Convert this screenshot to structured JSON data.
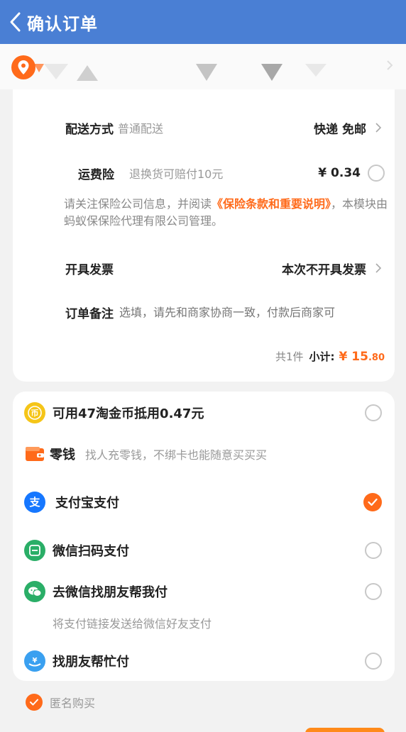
{
  "header": {
    "title": "确认订单"
  },
  "order": {
    "delivery": {
      "label": "配送方式",
      "sub": "普通配送",
      "value": "快递 免邮"
    },
    "insurance": {
      "label": "运费险",
      "sub": "退换货可赔付10元",
      "value": "¥ 0.34"
    },
    "notice": {
      "pre": "请关注保险公司信息，并阅读",
      "link": "《保险条款和重要说明》",
      "post": "，本模块由蚂蚁保保险代理有限公司管理。"
    },
    "invoice": {
      "label": "开具发票",
      "value": "本次不开具发票"
    },
    "remark": {
      "label": "订单备注",
      "placeholder": "选填，请先和商家协商一致，付款后商家可"
    },
    "total": {
      "count": "共1件",
      "subtotal_label": "小计:",
      "currency": "¥",
      "amount_int": "15",
      "amount_dec": ".80"
    }
  },
  "payment": {
    "coins": {
      "label": "可用47淘金币抵用0.47元"
    },
    "wallet": {
      "label": "零钱",
      "hint": "找人充零钱，不绑卡也能随意买买买"
    },
    "alipay": {
      "label": "支付宝支付",
      "selected": true
    },
    "wechat_scan": {
      "label": "微信扫码支付"
    },
    "wechat_friend": {
      "label": "去微信找朋友帮我付",
      "sub": "将支付链接发送给微信好友支付"
    },
    "friend_pay": {
      "label": "找朋友帮忙付"
    }
  },
  "anonymous": {
    "label": "匿名购买",
    "checked": true
  },
  "colors": {
    "header": "#4a7fd4",
    "accent": "#ff6a1a",
    "alipay": "#1677ff",
    "wechat": "#2aae67",
    "coin": "#f5c518"
  }
}
